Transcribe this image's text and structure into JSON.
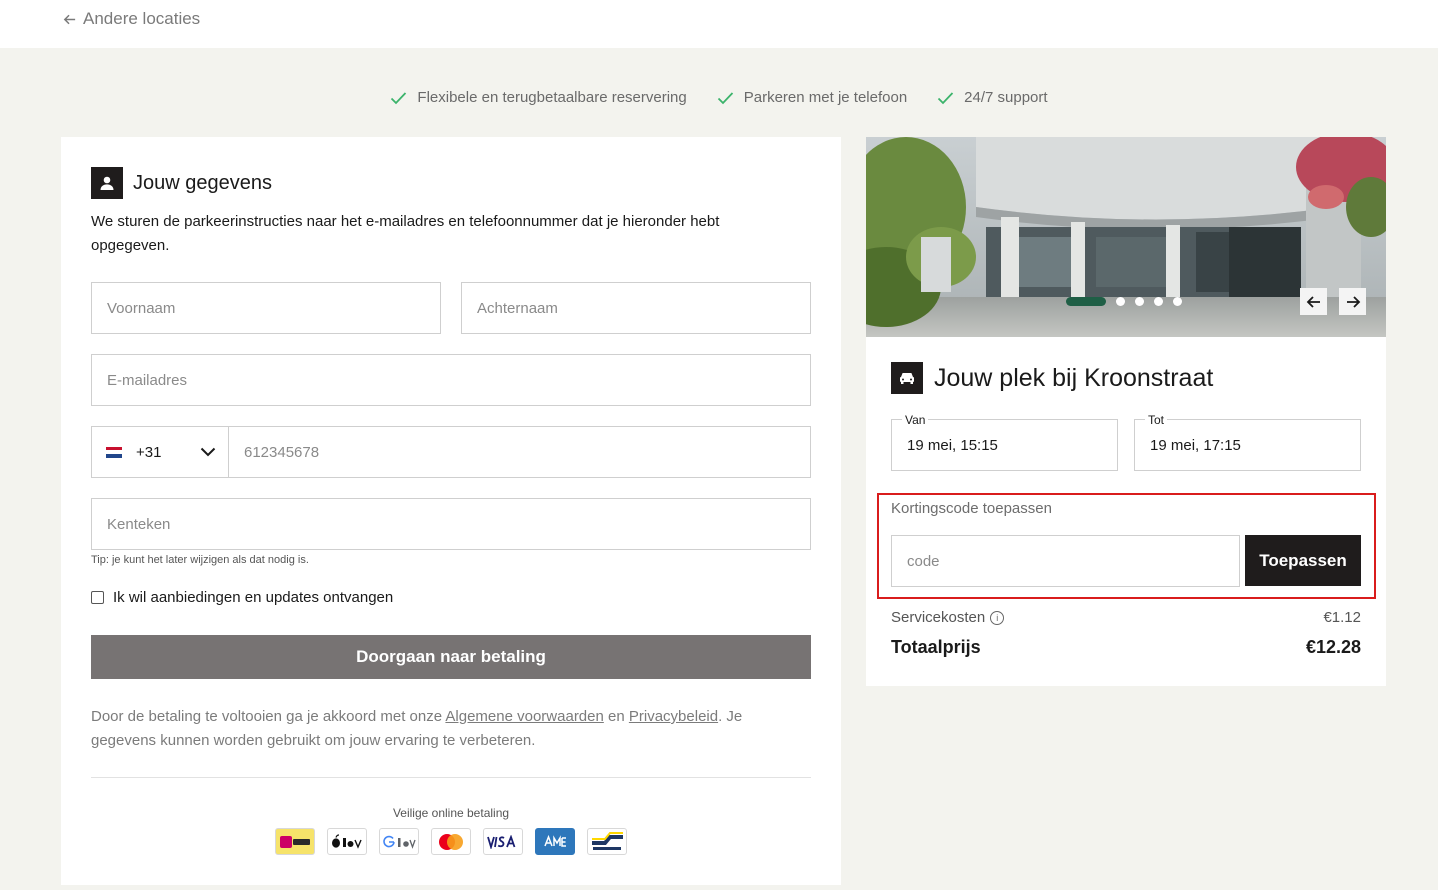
{
  "topbar": {
    "back_label": "Andere locaties"
  },
  "usps": [
    "Flexibele en terugbetaalbare reservering",
    "Parkeren met je telefoon",
    "24/7 support"
  ],
  "form": {
    "title": "Jouw gegevens",
    "description": "We sturen de parkeerinstructies naar het e-mailadres en telefoonnummer dat je hieronder hebt opgegeven.",
    "first_name_placeholder": "Voornaam",
    "last_name_placeholder": "Achternaam",
    "email_placeholder": "E-mailadres",
    "country_code": "+31",
    "phone_placeholder": "612345678",
    "plate_placeholder": "Kenteken",
    "plate_tip": "Tip: je kunt het later wijzigen als dat nodig is.",
    "offers_label": "Ik wil aanbiedingen en updates ontvangen",
    "submit_label": "Doorgaan naar betaling",
    "terms_prefix": "Door de betaling te voltooien ga je akkoord met onze ",
    "terms_link": "Algemene voorwaarden",
    "terms_middle": " en ",
    "privacy_link": "Privacybeleid",
    "terms_suffix": ". Je gegevens kunnen worden gebruikt om jouw ervaring te verbeteren.",
    "secure_label": "Veilige online betaling",
    "payment_methods": [
      "iDEAL | Wero",
      "Apple Pay",
      "Google Pay",
      "Mastercard",
      "VISA",
      "American Express",
      "Bancontact"
    ]
  },
  "summary": {
    "title": "Jouw plek bij Kroonstraat",
    "from_label": "Van",
    "from_value": "19 mei, 15:15",
    "to_label": "Tot",
    "to_value": "19 mei, 17:15",
    "promo_label": "Kortingscode toepassen",
    "promo_placeholder": "code",
    "apply_label": "Toepassen",
    "service_label": "Servicekosten",
    "service_value": "€1.12",
    "total_label": "Totaalprijs",
    "total_value": "€12.28",
    "carousel_slides": 5,
    "carousel_active": 1
  },
  "colors": {
    "page_bg": "#f3f3ee",
    "check_green": "#3bb36b",
    "dark": "#1f1c1c",
    "submit_disabled": "#777373",
    "highlight_red": "#d91c1c",
    "carousel_active": "#1f5f46"
  }
}
